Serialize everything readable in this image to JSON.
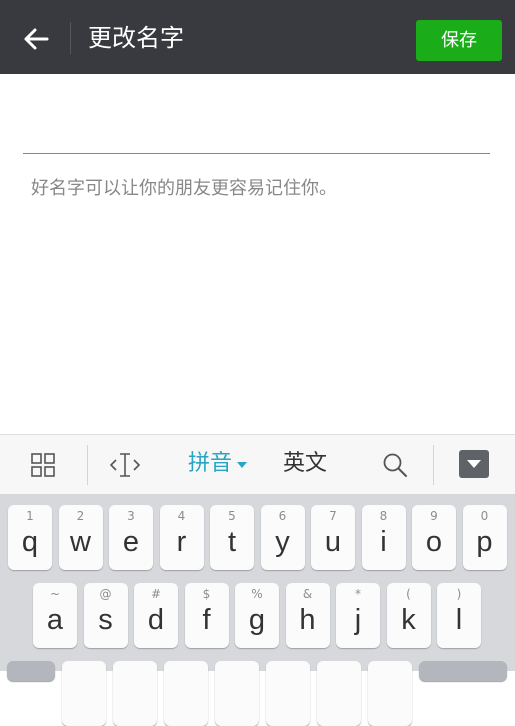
{
  "header": {
    "title": "更改名字",
    "save_label": "保存",
    "back_icon": "arrow-left-icon"
  },
  "form": {
    "value": "",
    "hint": "好名字可以让你的朋友更容易记住你。"
  },
  "ime_toolbar": {
    "pinyin_label": "拼音",
    "english_label": "英文",
    "icons": [
      "grid-icon",
      "cursor-icon",
      "search-icon",
      "collapse-keyboard-icon"
    ]
  },
  "keyboard": {
    "row1": [
      {
        "hint": "1",
        "key": "q"
      },
      {
        "hint": "2",
        "key": "w"
      },
      {
        "hint": "3",
        "key": "e"
      },
      {
        "hint": "4",
        "key": "r"
      },
      {
        "hint": "5",
        "key": "t"
      },
      {
        "hint": "6",
        "key": "y"
      },
      {
        "hint": "7",
        "key": "u"
      },
      {
        "hint": "8",
        "key": "i"
      },
      {
        "hint": "9",
        "key": "o"
      },
      {
        "hint": "0",
        "key": "p"
      }
    ],
    "row2": [
      {
        "hint": "~",
        "key": "a"
      },
      {
        "hint": "@",
        "key": "s"
      },
      {
        "hint": "#",
        "key": "d"
      },
      {
        "hint": "$",
        "key": "f"
      },
      {
        "hint": "%",
        "key": "g"
      },
      {
        "hint": "&",
        "key": "h"
      },
      {
        "hint": "*",
        "key": "j"
      },
      {
        "hint": "(",
        "key": "k"
      },
      {
        "hint": ")",
        "key": "l"
      }
    ]
  },
  "colors": {
    "header_bg": "#393a3f",
    "accent_green": "#1aad19",
    "underline_green": "#45c01a",
    "pinyin_blue": "#2aa4c4"
  }
}
